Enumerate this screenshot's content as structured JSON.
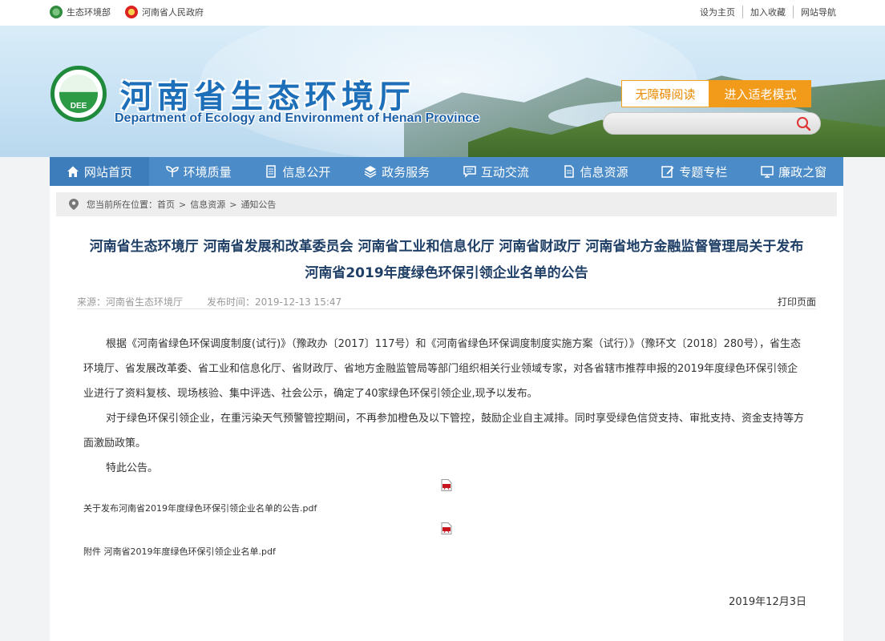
{
  "topbar": {
    "left_links": [
      "生态环境部",
      "河南省人民政府"
    ],
    "right_links": [
      "设为主页",
      "加入收藏",
      "网站导航"
    ]
  },
  "header": {
    "logo_text": "DEE",
    "title": "河南省生态环境厅",
    "subtitle": "Department of Ecology and Environment of Henan Province",
    "accessibility_button": "无障碍阅读",
    "elder_mode_button": "进入适老模式",
    "search_placeholder": ""
  },
  "nav": {
    "items": [
      "网站首页",
      "环境质量",
      "信息公开",
      "政务服务",
      "互动交流",
      "信息资源",
      "专题专栏",
      "廉政之窗"
    ]
  },
  "breadcrumb": {
    "prefix": "您当前所在位置：",
    "items": [
      "首页",
      "信息资源",
      "通知公告"
    ],
    "separator": ">"
  },
  "article": {
    "title_line1": "河南省生态环境厅 河南省发展和改革委员会 河南省工业和信息化厅 河南省财政厅 河南省地方金融监督管理局关于发布",
    "title_line2": "河南省2019年度绿色环保引领企业名单的公告",
    "source": "来源：河南省生态环境厅",
    "publish_time": "发布时间：2019-12-13 15:47",
    "print": "打印页面",
    "paragraphs": [
      "根据《河南省绿色环保调度制度(试行)》（豫政办〔2017〕117号）和《河南省绿色环保调度制度实施方案（试行）》（豫环文〔2018〕280号），省生态环境厅、省发展改革委、省工业和信息化厅、省财政厅、省地方金融监管局等部门组织相关行业领域专家，对各省辖市推荐申报的2019年度绿色环保引领企业进行了资料复核、现场核验、集中评选、社会公示，确定了40家绿色环保引领企业,现予以发布。",
      "对于绿色环保引领企业，在重污染天气预警管控期间，不再参加橙色及以下管控，鼓励企业自主减排。同时享受绿色信贷支持、审批支持、资金支持等方面激励政策。",
      "特此公告。"
    ],
    "attachments": [
      "关于发布河南省2019年度绿色环保引领企业名单的公告.pdf",
      "附件 河南省2019年度绿色环保引领企业名单.pdf"
    ],
    "date": "2019年12月3日"
  },
  "colors": {
    "nav_bg": "#4b8bc7",
    "title_blue": "#1c6fb8",
    "orange": "#f29a1a",
    "logo_green": "#1f8a3b"
  }
}
